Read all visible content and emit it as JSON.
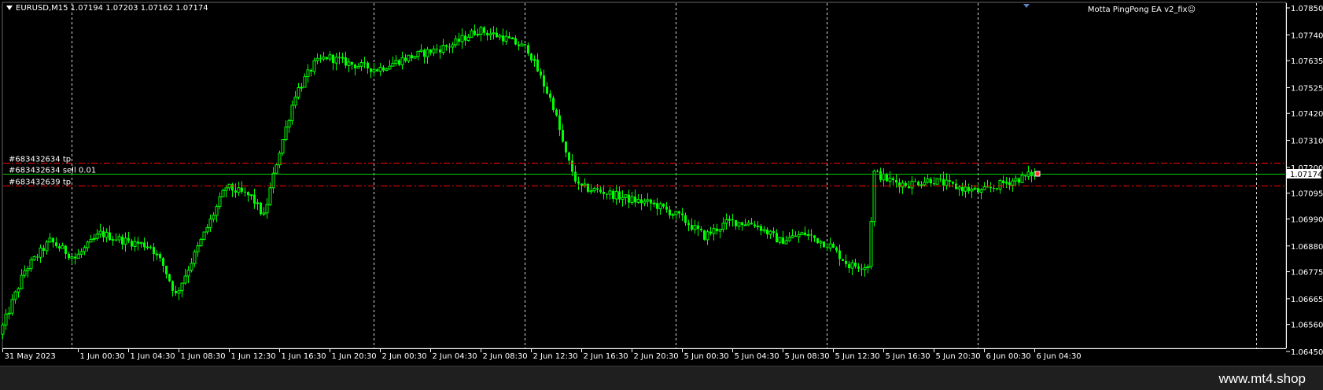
{
  "app": {
    "symbol_title": "EURUSD,M15  1.07194 1.07203 1.07162 1.07174",
    "ea_title": "Motta PingPong EA v2_fix☺",
    "watermark": "www.mt4.shop"
  },
  "colors": {
    "background": "#000000",
    "candle": "#00ff00",
    "grid": "#ffffff",
    "tp_line": "#ff0000",
    "price_line": "#00cc00"
  },
  "orders": [
    {
      "label": "#683432634 tp",
      "price": 1.0722,
      "style": "dash-dot"
    },
    {
      "label": "#683432634 sell 0.01",
      "price": 1.07174,
      "style": "solid"
    },
    {
      "label": "#683432639 tp",
      "price": 1.07125,
      "style": "dash-dot"
    }
  ],
  "current_price_label": "1.07174",
  "chart_data": {
    "type": "candlestick",
    "symbol": "EURUSD",
    "timeframe": "M15",
    "last_bar": {
      "open": 1.07194,
      "high": 1.07203,
      "low": 1.07162,
      "close": 1.07174
    },
    "y_ticks": [
      "1.07850",
      "1.07740",
      "1.07635",
      "1.07525",
      "1.07420",
      "1.07310",
      "1.07200",
      "1.07095",
      "1.06990",
      "1.06880",
      "1.06775",
      "1.06665",
      "1.06560",
      "1.06450"
    ],
    "ylim": [
      1.0645,
      1.0785
    ],
    "x_ticks": [
      "31 May 2023",
      "1 Jun 00:30",
      "1 Jun 04:30",
      "1 Jun 08:30",
      "1 Jun 12:30",
      "1 Jun 16:30",
      "1 Jun 20:30",
      "2 Jun 00:30",
      "2 Jun 04:30",
      "2 Jun 08:30",
      "2 Jun 12:30",
      "2 Jun 16:30",
      "2 Jun 20:30",
      "5 Jun 00:30",
      "5 Jun 04:30",
      "5 Jun 08:30",
      "5 Jun 12:30",
      "5 Jun 16:30",
      "5 Jun 20:30",
      "6 Jun 00:30",
      "6 Jun 04:30"
    ],
    "day_separators": [
      "1 Jun 00:00",
      "2 Jun 00:00",
      "2 Jun 12:00",
      "5 Jun 00:00",
      "5 Jun 12:00",
      "6 Jun 00:00"
    ],
    "close_path": [
      [
        "31 May 2023",
        1.0652
      ],
      [
        "31 May 20:30",
        1.0678
      ],
      [
        "31 May 22:30",
        1.069
      ],
      [
        "1 Jun 00:30",
        1.0683
      ],
      [
        "1 Jun 02:30",
        1.0693
      ],
      [
        "1 Jun 04:30",
        1.069
      ],
      [
        "1 Jun 06:30",
        1.0688
      ],
      [
        "1 Jun 07:30",
        1.068
      ],
      [
        "1 Jun 08:30",
        1.0668
      ],
      [
        "1 Jun 10:30",
        1.069
      ],
      [
        "1 Jun 12:30",
        1.0712
      ],
      [
        "1 Jun 14:30",
        1.0708
      ],
      [
        "1 Jun 15:30",
        1.07
      ],
      [
        "1 Jun 16:30",
        1.0722
      ],
      [
        "1 Jun 18:00",
        1.075
      ],
      [
        "1 Jun 19:30",
        1.0762
      ],
      [
        "1 Jun 20:30",
        1.0765
      ],
      [
        "1 Jun 22:30",
        1.0762
      ],
      [
        "2 Jun 00:30",
        1.076
      ],
      [
        "2 Jun 02:30",
        1.0764
      ],
      [
        "2 Jun 04:30",
        1.0767
      ],
      [
        "2 Jun 06:30",
        1.077
      ],
      [
        "2 Jun 08:30",
        1.0776
      ],
      [
        "2 Jun 10:30",
        1.0773
      ],
      [
        "2 Jun 12:30",
        1.0768
      ],
      [
        "2 Jun 14:30",
        1.0745
      ],
      [
        "2 Jun 15:30",
        1.0725
      ],
      [
        "2 Jun 16:30",
        1.0712
      ],
      [
        "2 Jun 18:30",
        1.071
      ],
      [
        "2 Jun 20:30",
        1.0707
      ],
      [
        "2 Jun 22:30",
        1.0705
      ],
      [
        "5 Jun 00:30",
        1.07
      ],
      [
        "5 Jun 02:30",
        1.0692
      ],
      [
        "5 Jun 04:30",
        1.0698
      ],
      [
        "5 Jun 06:30",
        1.0697
      ],
      [
        "5 Jun 08:30",
        1.069
      ],
      [
        "5 Jun 10:30",
        1.0693
      ],
      [
        "5 Jun 12:30",
        1.0688
      ],
      [
        "5 Jun 14:00",
        1.068
      ],
      [
        "5 Jun 15:30",
        1.068
      ],
      [
        "5 Jun 16:00",
        1.0718
      ],
      [
        "5 Jun 17:00",
        1.0715
      ],
      [
        "5 Jun 18:30",
        1.0713
      ],
      [
        "5 Jun 20:30",
        1.0715
      ],
      [
        "5 Jun 22:30",
        1.0712
      ],
      [
        "6 Jun 00:30",
        1.071
      ],
      [
        "6 Jun 02:30",
        1.0714
      ],
      [
        "6 Jun 04:00",
        1.0716
      ],
      [
        "6 Jun 04:30",
        1.07174
      ]
    ]
  }
}
